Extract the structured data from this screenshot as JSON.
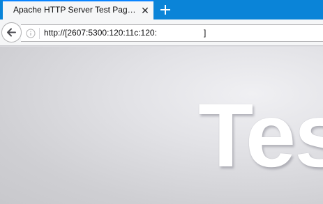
{
  "tab": {
    "title": "Apache HTTP Server Test Pag…",
    "close_glyph": "✕"
  },
  "new_tab": {
    "icon": "plus-icon"
  },
  "navbar": {
    "back_icon": "arrow-left-icon",
    "info_icon": "info-icon",
    "url": "http://[2607:5300:120:11c:120:",
    "url_end": "]"
  },
  "page": {
    "hero_text": "Tes"
  },
  "colors": {
    "tabbar": "#0a84d8",
    "accent": "#0a84ff",
    "toolbar": "#f5f6f7",
    "hero": "#ffffff"
  }
}
